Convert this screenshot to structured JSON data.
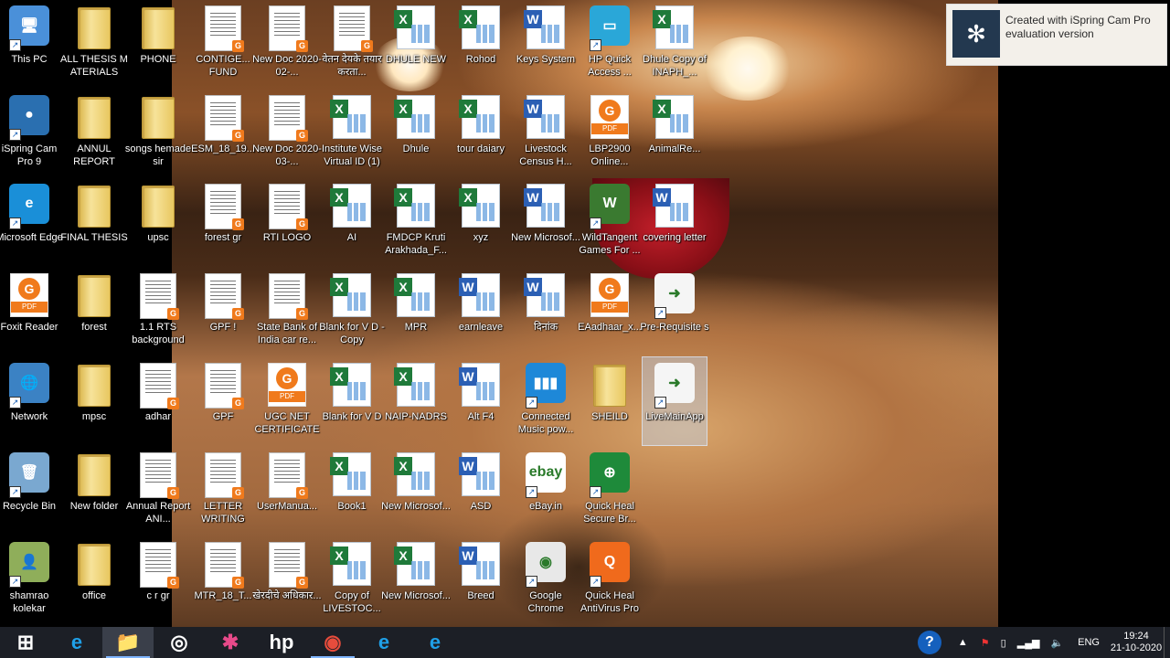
{
  "desktop": {
    "icons": [
      {
        "label": "This PC",
        "type": "app",
        "color": "#4a90d9",
        "glyph": "🖥"
      },
      {
        "label": "iSpring Cam Pro 9",
        "type": "app",
        "color": "#2a6fb0",
        "glyph": "●"
      },
      {
        "label": "Microsoft Edge",
        "type": "app",
        "color": "#1a8fd8",
        "glyph": "e"
      },
      {
        "label": "Foxit Reader",
        "type": "pdf"
      },
      {
        "label": "Network",
        "type": "app",
        "color": "#3b82c4",
        "glyph": "🌐"
      },
      {
        "label": "Recycle Bin",
        "type": "app",
        "color": "#7aa8d0",
        "glyph": "🗑"
      },
      {
        "label": "shamrao kolekar",
        "type": "app",
        "color": "#8fae5a",
        "glyph": "👤"
      },
      {
        "label": "ALL THESIS M ATERIALS",
        "type": "folder"
      },
      {
        "label": "ANNUL REPORT",
        "type": "folder"
      },
      {
        "label": "FINAL THESIS",
        "type": "folder"
      },
      {
        "label": "forest",
        "type": "folder"
      },
      {
        "label": "mpsc",
        "type": "folder"
      },
      {
        "label": "New folder",
        "type": "folder"
      },
      {
        "label": "office",
        "type": "folder"
      },
      {
        "label": "PHONE",
        "type": "folder"
      },
      {
        "label": "songs hemade sir",
        "type": "folder"
      },
      {
        "label": "upsc",
        "type": "folder"
      },
      {
        "label": "1.1 RTS background",
        "type": "doc"
      },
      {
        "label": "adhar",
        "type": "doc"
      },
      {
        "label": "Annual Report ANI...",
        "type": "doc"
      },
      {
        "label": "c r gr",
        "type": "doc"
      },
      {
        "label": "CONTIGE... FUND",
        "type": "doc"
      },
      {
        "label": "ESM_18_19...",
        "type": "doc"
      },
      {
        "label": "forest gr",
        "type": "doc"
      },
      {
        "label": "GPF !",
        "type": "doc"
      },
      {
        "label": "GPF",
        "type": "doc"
      },
      {
        "label": "LETTER WRITING",
        "type": "doc"
      },
      {
        "label": "MTR_18_T...",
        "type": "doc"
      },
      {
        "label": "New Doc 2020-02-...",
        "type": "doc"
      },
      {
        "label": "New Doc 2020-03-...",
        "type": "doc"
      },
      {
        "label": "RTI LOGO",
        "type": "doc"
      },
      {
        "label": "State Bank of India car re...",
        "type": "doc"
      },
      {
        "label": "UGC NET CERTIFICATE",
        "type": "pdf"
      },
      {
        "label": "UserManua...",
        "type": "doc"
      },
      {
        "label": "खेरदीचे अधिकार...",
        "type": "doc"
      },
      {
        "label": "वेतन देयके तयार करता...",
        "type": "doc"
      },
      {
        "label": "Institute Wise Virtual ID (1)",
        "type": "xl"
      },
      {
        "label": "AI",
        "type": "xl"
      },
      {
        "label": "Blank for V D - Copy",
        "type": "xl"
      },
      {
        "label": "Blank for V D",
        "type": "xl"
      },
      {
        "label": "Book1",
        "type": "xl"
      },
      {
        "label": "Copy of LIVESTOC...",
        "type": "xl"
      },
      {
        "label": "DHULE NEW",
        "type": "xl"
      },
      {
        "label": "Dhule",
        "type": "xl"
      },
      {
        "label": "FMDCP Kruti Arakhada_F...",
        "type": "xl"
      },
      {
        "label": "MPR",
        "type": "xl"
      },
      {
        "label": "NAIP-NADRS",
        "type": "xl"
      },
      {
        "label": "New Microsof...",
        "type": "xl"
      },
      {
        "label": "New Microsof...",
        "type": "xl"
      },
      {
        "label": "Rohod",
        "type": "xl"
      },
      {
        "label": "tour daiary",
        "type": "xl"
      },
      {
        "label": "xyz",
        "type": "xl"
      },
      {
        "label": "earnleave",
        "type": "wd"
      },
      {
        "label": "Alt F4",
        "type": "wd"
      },
      {
        "label": "ASD",
        "type": "wd"
      },
      {
        "label": "Breed",
        "type": "wd"
      },
      {
        "label": "Keys System",
        "type": "wd"
      },
      {
        "label": "Livestock Census H...",
        "type": "wd"
      },
      {
        "label": "New Microsof...",
        "type": "wd"
      },
      {
        "label": "दिनांक",
        "type": "wd"
      },
      {
        "label": "Connected Music pow...",
        "type": "app",
        "color": "#1e88d8",
        "glyph": "▮▮▮"
      },
      {
        "label": "eBay.in",
        "type": "app",
        "color": "#ffffff",
        "glyph": "ebay"
      },
      {
        "label": "Google Chrome",
        "type": "app",
        "color": "#e8e8e8",
        "glyph": "◉"
      },
      {
        "label": "HP Quick Access ...",
        "type": "app",
        "color": "#2aa7d8",
        "glyph": "▭"
      },
      {
        "label": "LBP2900 Online...",
        "type": "pdf"
      },
      {
        "label": "WildTangent Games For ...",
        "type": "app",
        "color": "#3a7a30",
        "glyph": "W"
      },
      {
        "label": "EAadhaar_x...",
        "type": "pdf"
      },
      {
        "label": "SHEILD",
        "type": "folder"
      },
      {
        "label": "Quick Heal Secure Br...",
        "type": "app",
        "color": "#1e8a3a",
        "glyph": "⊕"
      },
      {
        "label": "Quick Heal AntiVirus Pro",
        "type": "app",
        "color": "#f06a1c",
        "glyph": "Q"
      },
      {
        "label": "Dhule Copy of INAPH_...",
        "type": "xl"
      },
      {
        "label": "AnimalRe...",
        "type": "xl"
      },
      {
        "label": "covering letter",
        "type": "wd"
      },
      {
        "label": "Pre-Requisite s",
        "type": "app",
        "color": "#f5f5f5",
        "glyph": "➜"
      },
      {
        "label": "LiveMainApp",
        "type": "app",
        "color": "#f5f5f5",
        "glyph": "➜",
        "selected": true
      }
    ]
  },
  "notification": {
    "text": "Created with iSpring Cam Pro evaluation version"
  },
  "taskbar": {
    "items": [
      {
        "name": "start-button",
        "glyph": "⊞",
        "color": "#ffffff"
      },
      {
        "name": "internet-explorer",
        "glyph": "e",
        "color": "#1fa0e8"
      },
      {
        "name": "file-explorer",
        "glyph": "📁",
        "color": "#f2c94c"
      },
      {
        "name": "ispring-cam",
        "glyph": "◎",
        "color": "#ffffff"
      },
      {
        "name": "paint-app",
        "glyph": "✱",
        "color": "#e84a8a"
      },
      {
        "name": "hp-app",
        "glyph": "hp",
        "color": "#ffffff"
      },
      {
        "name": "chrome",
        "glyph": "◉",
        "color": "#e74c3c"
      },
      {
        "name": "edge",
        "glyph": "e",
        "color": "#1fa0e8"
      },
      {
        "name": "edge-2",
        "glyph": "e",
        "color": "#1fa0e8"
      }
    ],
    "language": "ENG",
    "time": "19:24",
    "date": "21-10-2020"
  }
}
